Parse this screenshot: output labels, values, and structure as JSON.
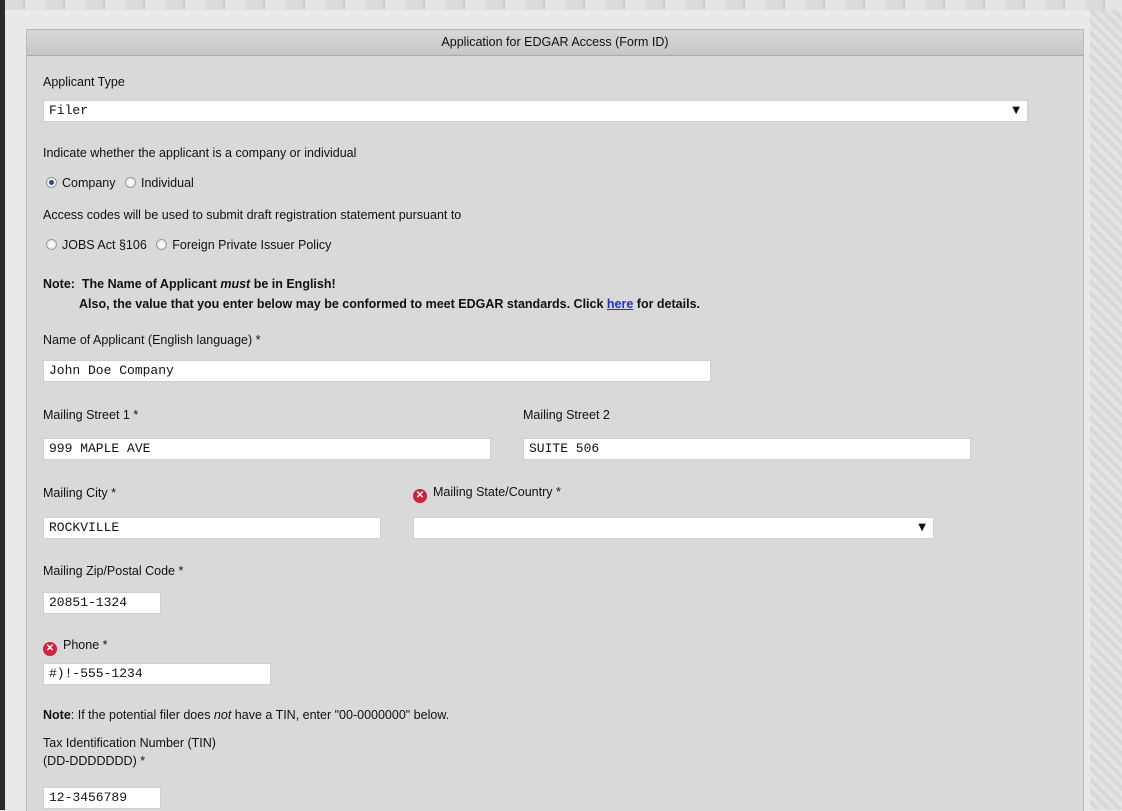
{
  "header": {
    "title": "Application for EDGAR Access (Form ID)"
  },
  "applicant_type": {
    "label": "Applicant Type",
    "value": "Filer"
  },
  "entity_type": {
    "question": "Indicate whether the applicant is a company or individual",
    "options": [
      "Company",
      "Individual"
    ],
    "selected": "Company"
  },
  "access_codes": {
    "question": "Access codes will be used to submit draft registration statement pursuant to",
    "options": [
      "JOBS Act §106",
      "Foreign Private Issuer Policy"
    ]
  },
  "name_note": {
    "prefix": "Note:",
    "line1_a": "The Name of Applicant ",
    "line1_em": "must",
    "line1_b": " be in English!",
    "line2_a": "Also, the value that you enter below may be conformed to meet EDGAR standards. Click ",
    "line2_link": "here",
    "line2_b": " for details."
  },
  "applicant_name": {
    "label": "Name of Applicant (English language) *",
    "value": "John Doe Company"
  },
  "mailing_street1": {
    "label": "Mailing Street 1 *",
    "value": "999 MAPLE AVE"
  },
  "mailing_street2": {
    "label": "Mailing Street 2",
    "value": "SUITE 506"
  },
  "mailing_city": {
    "label": "Mailing City *",
    "value": "ROCKVILLE"
  },
  "mailing_state": {
    "label": "Mailing State/Country *",
    "value": ""
  },
  "mailing_zip": {
    "label": "Mailing Zip/Postal Code *",
    "value": "20851-1324"
  },
  "phone": {
    "label": "Phone *",
    "value": "#)!-555-1234"
  },
  "tin_note": {
    "prefix": "Note",
    "text_a": ": If the potential filer does ",
    "text_em": "not",
    "text_b": " have a TIN, enter \"00-0000000\" below."
  },
  "tin": {
    "label_line1": "Tax Identification Number (TIN)",
    "label_line2": "(DD-DDDDDDD) *",
    "value": "12-3456789"
  },
  "colors": {
    "error": "#d0233a",
    "link": "#1a33c9",
    "panel": "#d9d9d9"
  }
}
